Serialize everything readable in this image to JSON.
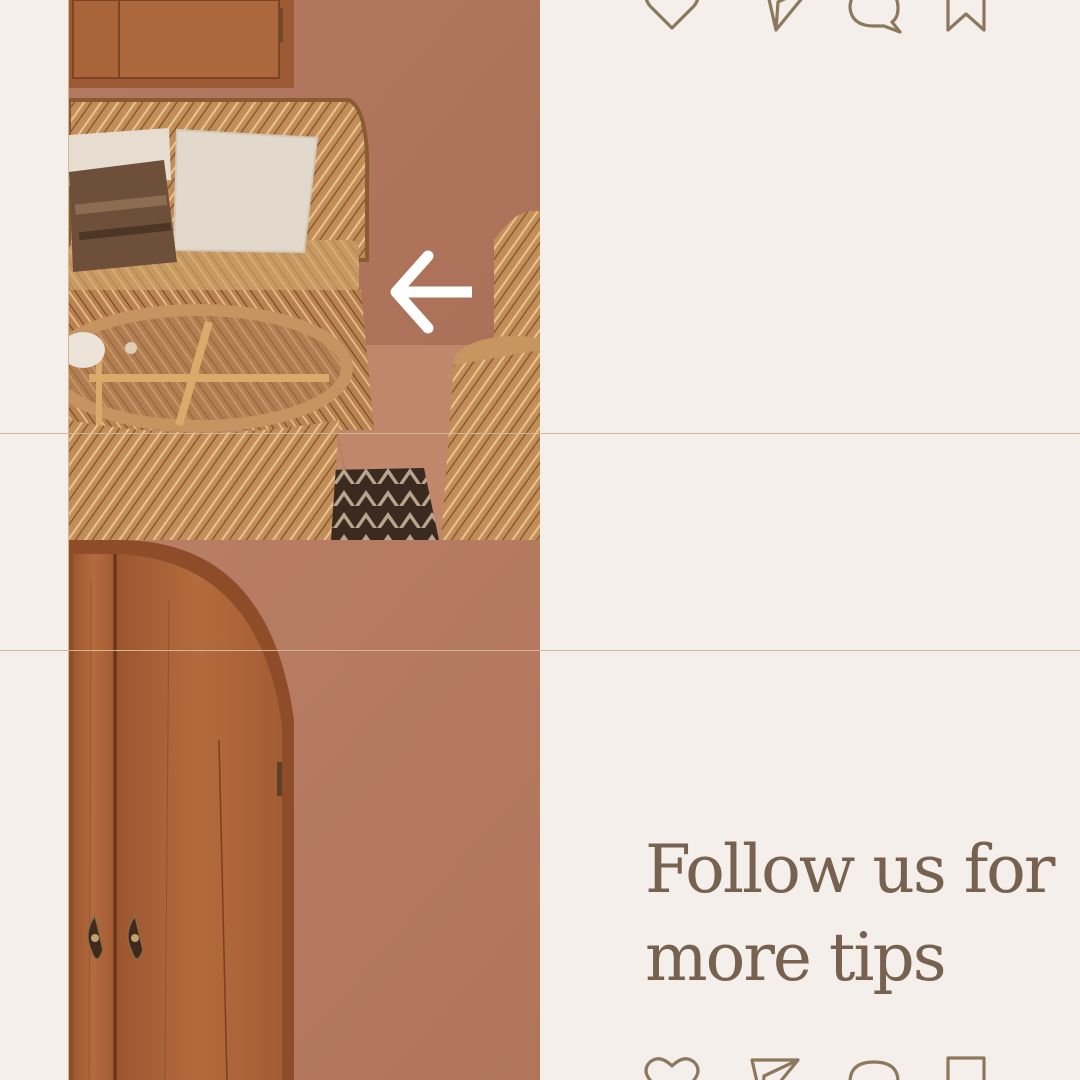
{
  "post": {
    "cta_text": "Follow us for more tips"
  },
  "colors": {
    "background": "#f5efeb",
    "text": "#76624f",
    "icon_stroke": "#8c785c",
    "guide_line": "#d2b792",
    "arrow": "#ffffff",
    "terracotta_wall": "#b57a61",
    "wood_door": "#a85f33",
    "rattan": "#c9975f"
  },
  "icons": {
    "top_row": [
      "heart-icon",
      "send-icon",
      "comment-icon",
      "bookmark-icon"
    ],
    "bottom_row": [
      "heart-icon",
      "send-icon",
      "comment-icon",
      "bookmark-icon"
    ],
    "nav": "arrow-left-icon"
  },
  "photos": {
    "top": "rattan-living-room-photo",
    "bottom": "arched-wooden-door-photo"
  }
}
